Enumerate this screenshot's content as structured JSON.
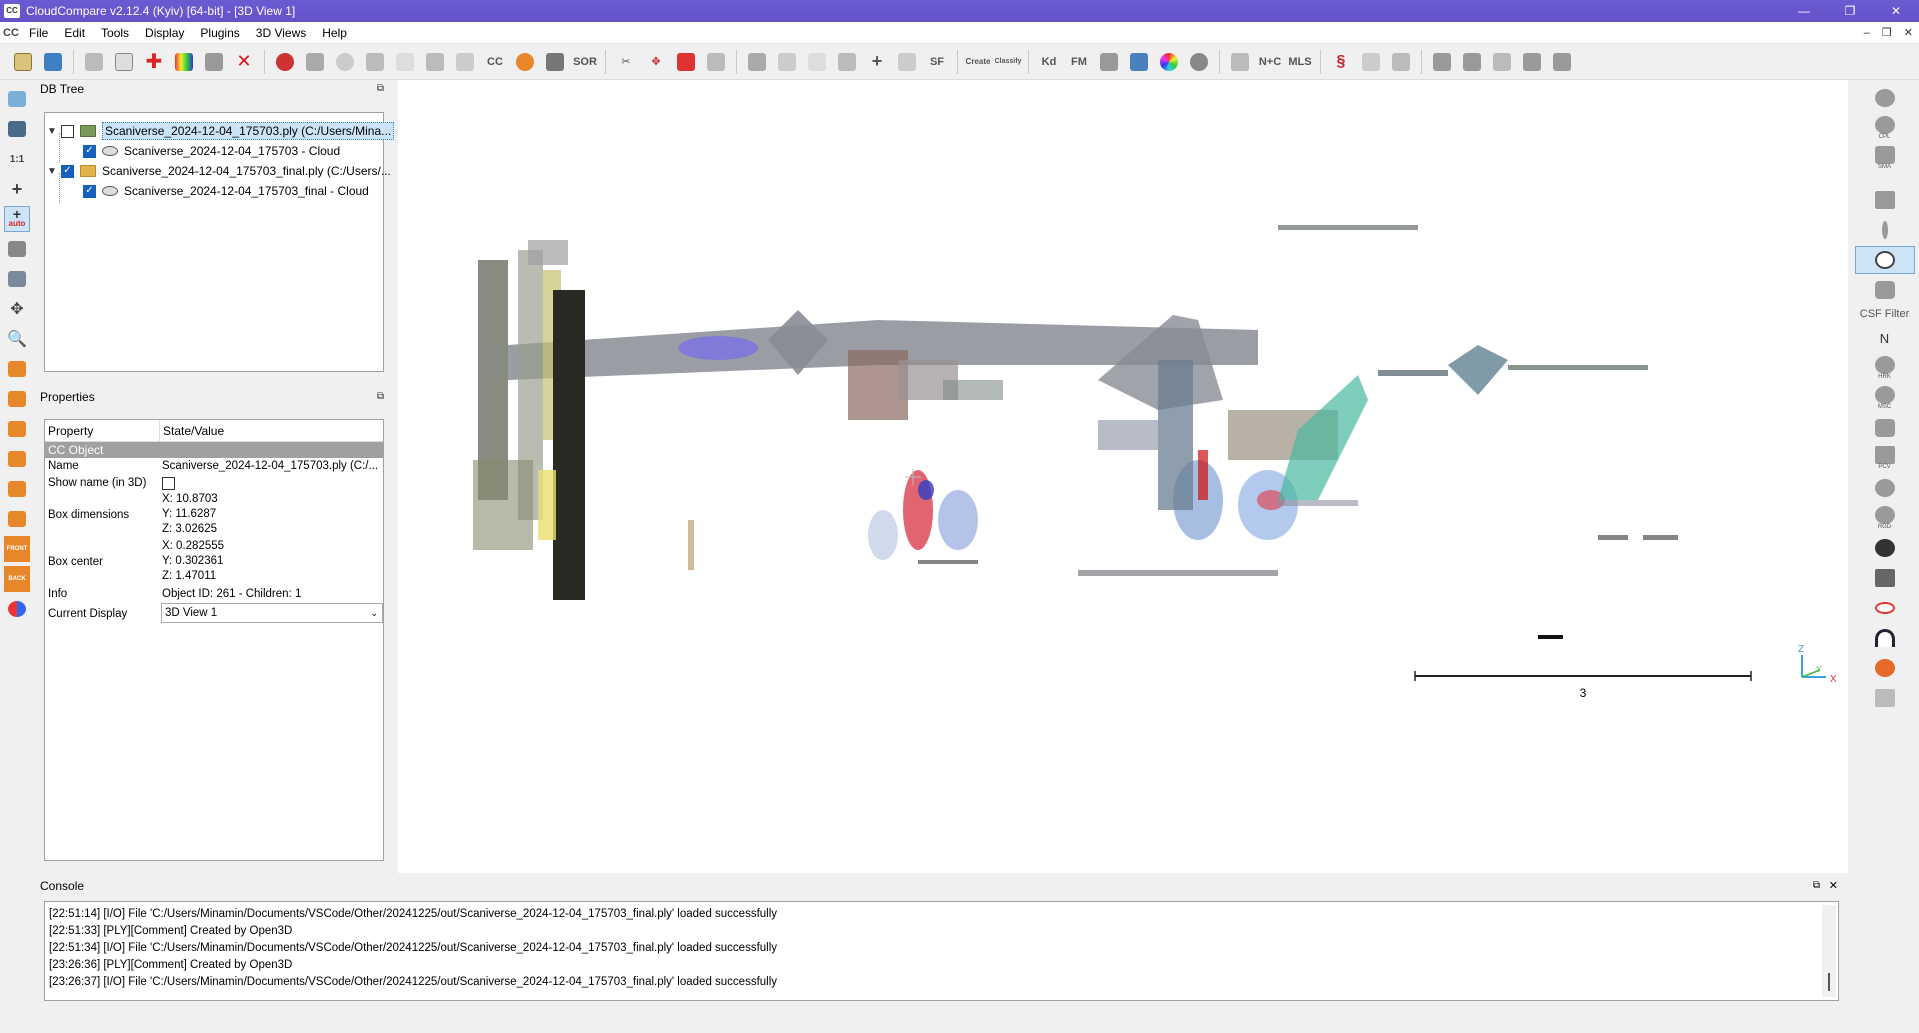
{
  "window": {
    "title": "CloudCompare v2.12.4 (Kyiv) [64-bit] - [3D View 1]",
    "app_icon": "CC",
    "controls": [
      "—",
      "❐",
      "✕"
    ]
  },
  "menubar": {
    "logo": "CC",
    "items": [
      "File",
      "Edit",
      "Tools",
      "Display",
      "Plugins",
      "3D Views",
      "Help"
    ],
    "mdi_controls": [
      "–",
      "❐",
      "✕"
    ]
  },
  "toolbar": {
    "text_buttons": {
      "sor": "SOR",
      "cc": "CC",
      "sf": "SF",
      "kd": "Kd",
      "fm": "FM",
      "nc": "N+C",
      "mls": "MLS",
      "canupo_create": "Create",
      "canupo_classify": "Classify"
    }
  },
  "left_toolbar": {
    "one_to_one": "1:1",
    "auto": "auto",
    "front": "FRONT",
    "back": "BACK"
  },
  "db_tree": {
    "header": "DB Tree",
    "items": [
      {
        "label": "Scaniverse_2024-12-04_175703.ply (C:/Users/Mina..."
      },
      {
        "label": "Scaniverse_2024-12-04_175703 - Cloud"
      },
      {
        "label": "Scaniverse_2024-12-04_175703_final.ply (C:/Users/..."
      },
      {
        "label": "Scaniverse_2024-12-04_175703_final - Cloud"
      }
    ]
  },
  "properties": {
    "header": "Properties",
    "col_property": "Property",
    "col_value": "State/Value",
    "section": "CC Object",
    "name_key": "Name",
    "name_value": "Scaniverse_2024-12-04_175703.ply (C:/...",
    "show_name_key": "Show name (in 3D)",
    "box_dim_key": "Box dimensions",
    "box_dim": [
      "X: 10.8703",
      "Y: 11.6287",
      "Z: 3.02625"
    ],
    "box_center_key": "Box center",
    "box_center": [
      "X: 0.282555",
      "Y: 0.302361",
      "Z: 1.47011"
    ],
    "info_key": "Info",
    "info_value": "Object ID: 261 - Children: 1",
    "display_key": "Current Display",
    "display_value": "3D View 1"
  },
  "view3d": {
    "scale_label": "3",
    "axis_z": "Z",
    "axis_y": "Y",
    "axis_x": "X"
  },
  "right_toolbar": {
    "csf_label": "CSF Filter",
    "n_label": "N",
    "labels": [
      "CPL",
      "SMA",
      "MSC",
      "HRK",
      "PCV",
      "RGD"
    ]
  },
  "console": {
    "header": "Console",
    "lines": [
      "[22:51:14] [I/O] File 'C:/Users/Minamin/Documents/VSCode/Other/20241225/out/Scaniverse_2024-12-04_175703_final.ply' loaded successfully",
      "[22:51:33] [PLY][Comment] Created by Open3D",
      "[22:51:34] [I/O] File 'C:/Users/Minamin/Documents/VSCode/Other/20241225/out/Scaniverse_2024-12-04_175703_final.ply' loaded successfully",
      "[23:26:36] [PLY][Comment] Created by Open3D",
      "[23:26:37] [I/O] File 'C:/Users/Minamin/Documents/VSCode/Other/20241225/out/Scaniverse_2024-12-04_175703_final.ply' loaded successfully"
    ]
  }
}
